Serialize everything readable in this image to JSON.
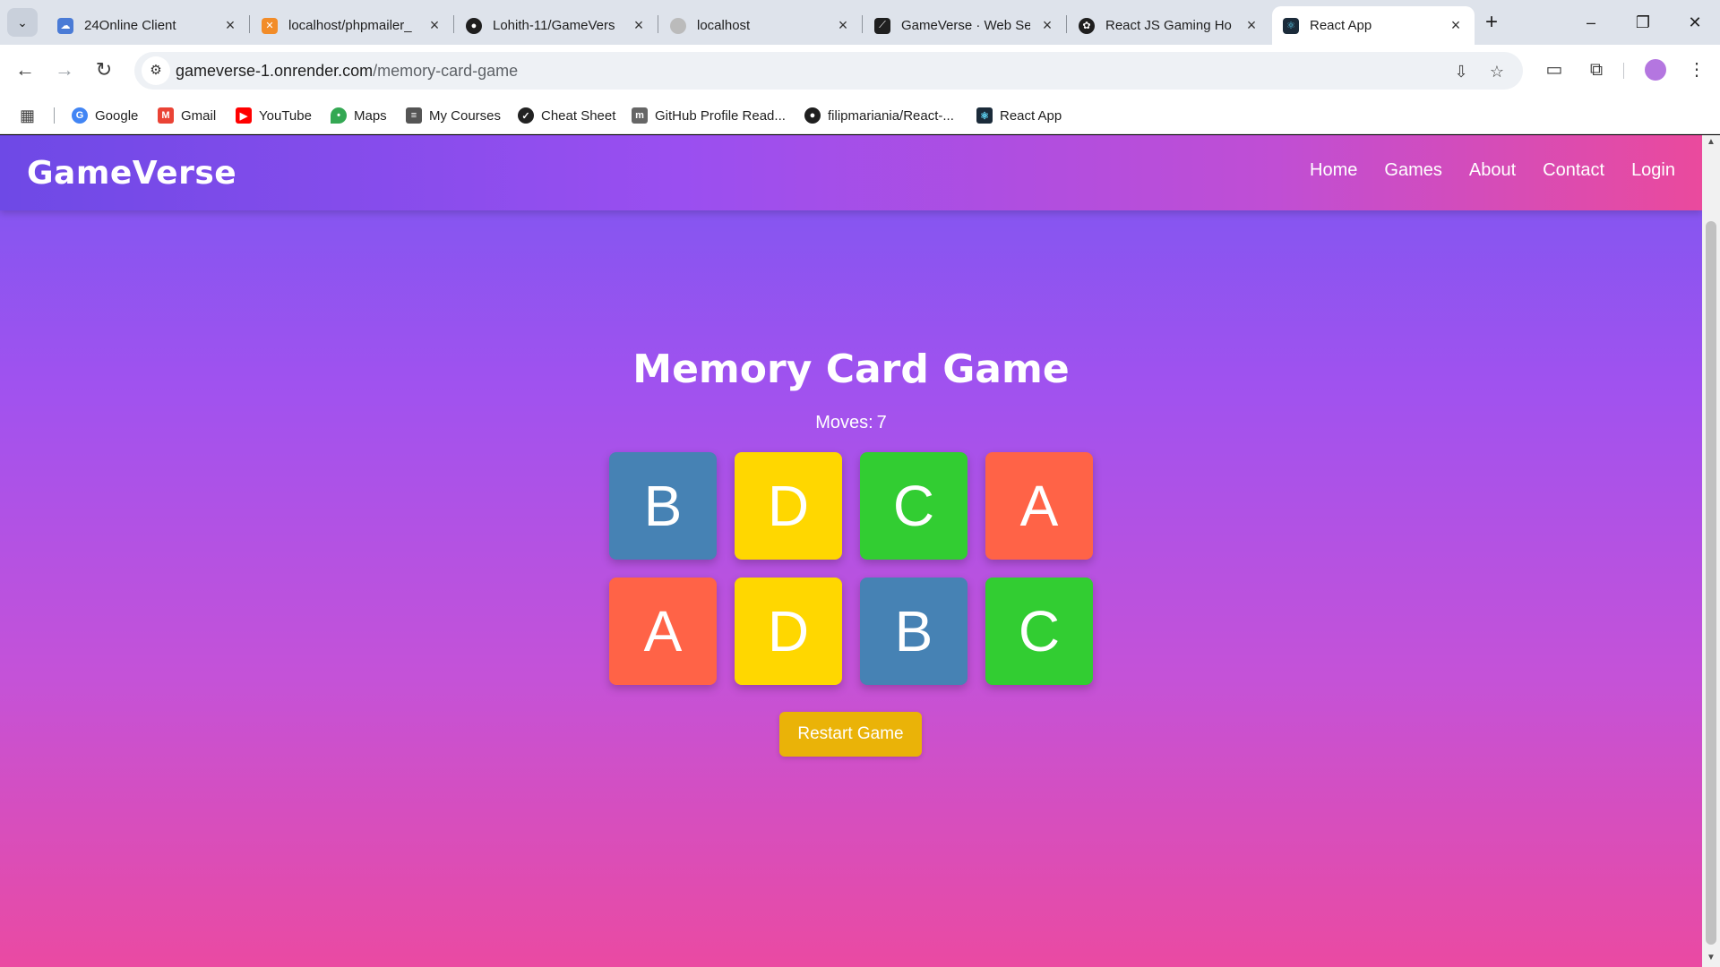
{
  "browser": {
    "tabs": [
      {
        "title": "24Online Client",
        "icon": "cloud-icon",
        "color": "#4a7bd6"
      },
      {
        "title": "localhost/phpmailer_",
        "icon": "xampp-icon",
        "color": "#f28c28"
      },
      {
        "title": "Lohith-11/GameVers",
        "icon": "github-icon",
        "color": "#1f1f1f"
      },
      {
        "title": "localhost",
        "icon": "globe-icon",
        "color": "#bbbbbb"
      },
      {
        "title": "GameVerse · Web Se",
        "icon": "render-icon",
        "color": "#1f1f1f"
      },
      {
        "title": "React JS Gaming Ho",
        "icon": "openai-icon",
        "color": "#1f1f1f"
      },
      {
        "title": "React App",
        "icon": "react-icon",
        "color": "#1b2b3a"
      }
    ],
    "url_host": "gameverse-1.onrender.com",
    "url_path": "/memory-card-game",
    "bookmarks": [
      {
        "label": "Google",
        "icon": "google-icon",
        "color": "#4285f4"
      },
      {
        "label": "Gmail",
        "icon": "gmail-icon",
        "color": "#ea4335"
      },
      {
        "label": "YouTube",
        "icon": "youtube-icon",
        "color": "#ff0000"
      },
      {
        "label": "Maps",
        "icon": "maps-icon",
        "color": "#34a853"
      },
      {
        "label": "My Courses",
        "icon": "courses-icon",
        "color": "#555555"
      },
      {
        "label": "Cheat Sheet",
        "icon": "cheatsheet-icon",
        "color": "#222222"
      },
      {
        "label": "GitHub Profile Read...",
        "icon": "readme-icon",
        "color": "#666666"
      },
      {
        "label": "filipmariania/React-...",
        "icon": "github-icon",
        "color": "#1f1f1f"
      },
      {
        "label": "React App",
        "icon": "react-icon",
        "color": "#1b2b3a"
      }
    ]
  },
  "app": {
    "brand": "GameVerse",
    "nav": [
      "Home",
      "Games",
      "About",
      "Contact",
      "Login"
    ]
  },
  "game": {
    "title": "Memory Card Game",
    "moves_label": "Moves:",
    "moves": "7",
    "cards": [
      {
        "letter": "B",
        "color": "#4682b4"
      },
      {
        "letter": "D",
        "color": "#ffd700"
      },
      {
        "letter": "C",
        "color": "#32cd32"
      },
      {
        "letter": "A",
        "color": "#ff6347"
      },
      {
        "letter": "A",
        "color": "#ff6347"
      },
      {
        "letter": "D",
        "color": "#ffd700"
      },
      {
        "letter": "B",
        "color": "#4682b4"
      },
      {
        "letter": "C",
        "color": "#32cd32"
      }
    ],
    "restart_label": "Restart Game"
  }
}
